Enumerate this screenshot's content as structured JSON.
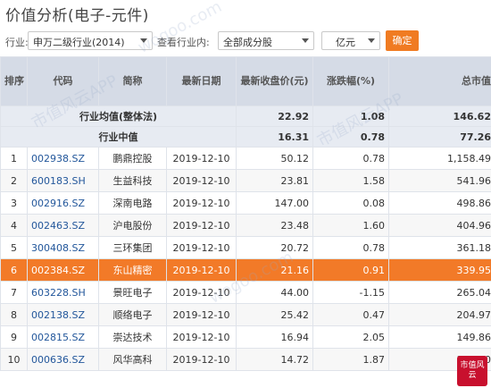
{
  "title": "价值分析(电子-元件)",
  "filters": {
    "industry_label": "行业:",
    "industry_value": "申万二级行业(2014)",
    "view_label": "查看行业内:",
    "scope_value": "全部成分股",
    "unit_value": "亿元",
    "confirm_label": "确定"
  },
  "table": {
    "headers": [
      "排序",
      "代码",
      "简称",
      "最新日期",
      "最新收盘价(元)",
      "涨跌幅(%)",
      "总市值"
    ],
    "summary": [
      {
        "label": "行业均值(整体法)",
        "close": "22.92",
        "change": "1.08",
        "mktcap": "146.62"
      },
      {
        "label": "行业中值",
        "close": "16.31",
        "change": "0.78",
        "mktcap": "77.26"
      }
    ],
    "rows": [
      {
        "rank": "1",
        "code": "002938.SZ",
        "name": "鹏鼎控股",
        "date": "2019-12-10",
        "close": "50.12",
        "change": "0.78",
        "mktcap": "1,158.49"
      },
      {
        "rank": "2",
        "code": "600183.SH",
        "name": "生益科技",
        "date": "2019-12-10",
        "close": "23.81",
        "change": "1.58",
        "mktcap": "541.96"
      },
      {
        "rank": "3",
        "code": "002916.SZ",
        "name": "深南电路",
        "date": "2019-12-10",
        "close": "147.00",
        "change": "0.08",
        "mktcap": "498.86"
      },
      {
        "rank": "4",
        "code": "002463.SZ",
        "name": "沪电股份",
        "date": "2019-12-10",
        "close": "23.48",
        "change": "1.60",
        "mktcap": "404.96"
      },
      {
        "rank": "5",
        "code": "300408.SZ",
        "name": "三环集团",
        "date": "2019-12-10",
        "close": "20.72",
        "change": "0.78",
        "mktcap": "361.18"
      },
      {
        "rank": "6",
        "code": "002384.SZ",
        "name": "东山精密",
        "date": "2019-12-10",
        "close": "21.16",
        "change": "0.91",
        "mktcap": "339.95"
      },
      {
        "rank": "7",
        "code": "603228.SH",
        "name": "景旺电子",
        "date": "2019-12-10",
        "close": "44.00",
        "change": "-1.15",
        "mktcap": "265.04"
      },
      {
        "rank": "8",
        "code": "002138.SZ",
        "name": "顺络电子",
        "date": "2019-12-10",
        "close": "25.42",
        "change": "0.47",
        "mktcap": "204.97"
      },
      {
        "rank": "9",
        "code": "002815.SZ",
        "name": "崇达技术",
        "date": "2019-12-10",
        "close": "16.94",
        "change": "2.05",
        "mktcap": "149.86"
      },
      {
        "rank": "10",
        "code": "000636.SZ",
        "name": "风华高科",
        "date": "2019-12-10",
        "close": "14.72",
        "change": "1.87",
        "mktcap": "131.80"
      }
    ]
  },
  "watermark": [
    "wogoo.com",
    "市值风云APP"
  ],
  "logo_text": "市值风云",
  "colors": {
    "accent": "#f07b22",
    "highlight_row": "#f27a28",
    "header_bg": "#d5dbe6",
    "code_link": "#23579b"
  }
}
